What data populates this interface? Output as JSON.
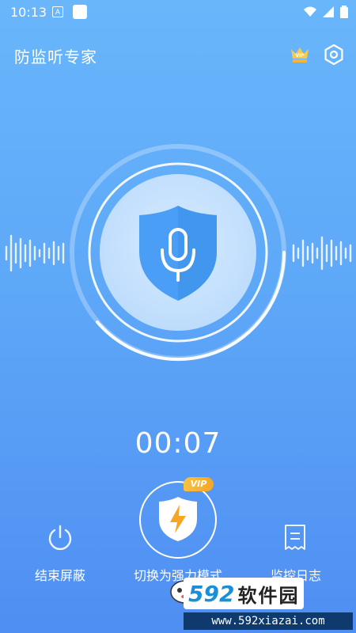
{
  "status_bar": {
    "time": "10:13",
    "notif_letter": "A"
  },
  "header": {
    "title": "防监听专家",
    "vip_icon": "crown-icon",
    "settings_icon": "gear-icon"
  },
  "main": {
    "center_icon": "shield-microphone-icon",
    "timer": "00:07"
  },
  "actions": {
    "end_shield_label": "结束屏蔽",
    "switch_mode_label": "切换为强力模式",
    "vip_badge": "VIP",
    "log_label": "监控日志"
  },
  "watermark": {
    "number": "592",
    "name": "软件园",
    "url": "www.592xiazai.com"
  },
  "colors": {
    "bg_top": "#69b6fb",
    "bg_bottom": "#4f8ef2",
    "shield": "#4a9ef5",
    "vip": "#f5a623"
  }
}
